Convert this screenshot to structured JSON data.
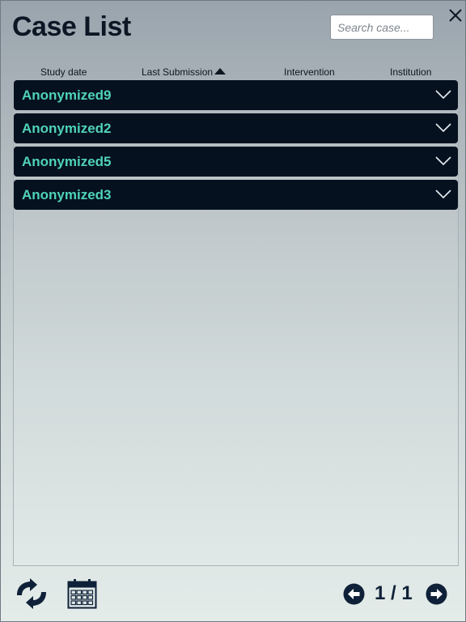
{
  "header": {
    "title": "Case List",
    "search_placeholder": "Search case..."
  },
  "columns": [
    {
      "label": "Study date"
    },
    {
      "label": "Last Submission",
      "sorted": "ascending"
    },
    {
      "label": "Intervention"
    },
    {
      "label": "Institution"
    }
  ],
  "cases": [
    {
      "name": "Anonymized9"
    },
    {
      "name": "Anonymized2"
    },
    {
      "name": "Anonymized5"
    },
    {
      "name": "Anonymized3"
    }
  ],
  "footer": {
    "refresh_icon": "refresh-icon",
    "calendar_icon": "calendar-icon",
    "page_indicator": "1 / 1"
  },
  "colors": {
    "title": "#0c1726",
    "row_background": "#06111f",
    "row_text": "#4fd3b8",
    "icon": "#0f2138"
  }
}
